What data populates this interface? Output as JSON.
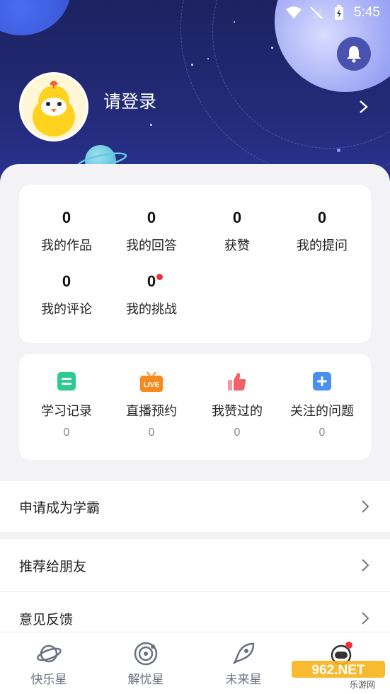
{
  "status_bar": {
    "time": "5:45"
  },
  "profile": {
    "login_prompt": "请登录"
  },
  "stats": [
    {
      "count": "0",
      "label": "我的作品"
    },
    {
      "count": "0",
      "label": "我的回答"
    },
    {
      "count": "0",
      "label": "获赞"
    },
    {
      "count": "0",
      "label": "我的提问"
    },
    {
      "count": "0",
      "label": "我的评论"
    },
    {
      "count": "0",
      "label": "我的挑战"
    }
  ],
  "tools": [
    {
      "label": "学习记录",
      "count": "0",
      "icon": "note-icon",
      "color": "#2ecb8f"
    },
    {
      "label": "直播预约",
      "count": "0",
      "icon": "live-tv-icon",
      "color": "#f58a1f",
      "badge": "LIVE"
    },
    {
      "label": "我赞过的",
      "count": "0",
      "icon": "thumbs-up-icon",
      "color": "#f2606a"
    },
    {
      "label": "关注的问题",
      "count": "0",
      "icon": "plus-square-icon",
      "color": "#4a90f0"
    }
  ],
  "menu": [
    {
      "label": "申请成为学霸"
    },
    {
      "label": "推荐给朋友"
    },
    {
      "label": "意见反馈"
    }
  ],
  "bottom_nav": [
    {
      "label": "快乐星",
      "icon": "planet-icon"
    },
    {
      "label": "解忧星",
      "icon": "galaxy-icon"
    },
    {
      "label": "未来星",
      "icon": "rocket-icon"
    },
    {
      "label": "",
      "icon": "astronaut-icon"
    }
  ],
  "watermark": {
    "main": "962.NET",
    "sub": "乐游网"
  },
  "colors": {
    "header_bg": "#232a78",
    "accent_red": "#e8343a"
  }
}
